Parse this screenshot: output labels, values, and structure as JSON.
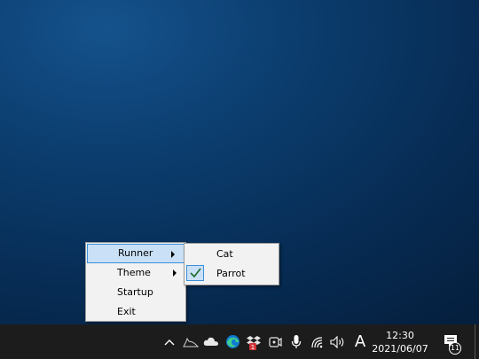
{
  "context_menu": {
    "items": [
      {
        "label": "Runner",
        "has_submenu": true,
        "active": true
      },
      {
        "label": "Theme",
        "has_submenu": true,
        "active": false
      },
      {
        "label": "Startup",
        "has_submenu": false,
        "active": false
      },
      {
        "label": "Exit",
        "has_submenu": false,
        "active": false
      }
    ]
  },
  "submenu": {
    "items": [
      {
        "label": "Cat",
        "checked": false
      },
      {
        "label": "Parrot",
        "checked": true
      }
    ]
  },
  "taskbar": {
    "tray_icons": [
      "chevron-up-icon",
      "runner-cat-icon",
      "onedrive-cloud-icon",
      "edge-browser-icon",
      "dropbox-icon",
      "meet-now-icon",
      "microphone-icon",
      "wifi-icon",
      "volume-icon"
    ],
    "ime_indicator": "A",
    "clock": {
      "time": "12:30",
      "date": "2021/06/07"
    },
    "notification_count": "11",
    "dropbox_badge": "1"
  },
  "colors": {
    "taskbar_bg": "#1c1c1c",
    "menu_bg": "#f2f2f2",
    "highlight_bg": "#c9e0f7",
    "highlight_border": "#3a8fd8",
    "edge_accent": "#0f7bd0",
    "dropbox_badge": "#d13438"
  }
}
